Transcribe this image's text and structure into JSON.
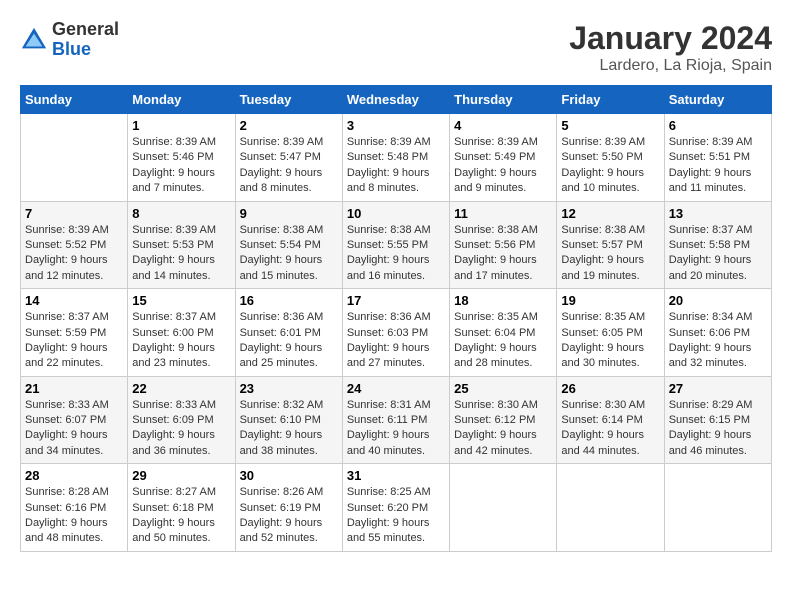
{
  "logo": {
    "general": "General",
    "blue": "Blue"
  },
  "title": "January 2024",
  "subtitle": "Lardero, La Rioja, Spain",
  "days_header": [
    "Sunday",
    "Monday",
    "Tuesday",
    "Wednesday",
    "Thursday",
    "Friday",
    "Saturday"
  ],
  "weeks": [
    [
      {
        "day": "",
        "info": ""
      },
      {
        "day": "1",
        "info": "Sunrise: 8:39 AM\nSunset: 5:46 PM\nDaylight: 9 hours\nand 7 minutes."
      },
      {
        "day": "2",
        "info": "Sunrise: 8:39 AM\nSunset: 5:47 PM\nDaylight: 9 hours\nand 8 minutes."
      },
      {
        "day": "3",
        "info": "Sunrise: 8:39 AM\nSunset: 5:48 PM\nDaylight: 9 hours\nand 8 minutes."
      },
      {
        "day": "4",
        "info": "Sunrise: 8:39 AM\nSunset: 5:49 PM\nDaylight: 9 hours\nand 9 minutes."
      },
      {
        "day": "5",
        "info": "Sunrise: 8:39 AM\nSunset: 5:50 PM\nDaylight: 9 hours\nand 10 minutes."
      },
      {
        "day": "6",
        "info": "Sunrise: 8:39 AM\nSunset: 5:51 PM\nDaylight: 9 hours\nand 11 minutes."
      }
    ],
    [
      {
        "day": "7",
        "info": "Sunrise: 8:39 AM\nSunset: 5:52 PM\nDaylight: 9 hours\nand 12 minutes."
      },
      {
        "day": "8",
        "info": "Sunrise: 8:39 AM\nSunset: 5:53 PM\nDaylight: 9 hours\nand 14 minutes."
      },
      {
        "day": "9",
        "info": "Sunrise: 8:38 AM\nSunset: 5:54 PM\nDaylight: 9 hours\nand 15 minutes."
      },
      {
        "day": "10",
        "info": "Sunrise: 8:38 AM\nSunset: 5:55 PM\nDaylight: 9 hours\nand 16 minutes."
      },
      {
        "day": "11",
        "info": "Sunrise: 8:38 AM\nSunset: 5:56 PM\nDaylight: 9 hours\nand 17 minutes."
      },
      {
        "day": "12",
        "info": "Sunrise: 8:38 AM\nSunset: 5:57 PM\nDaylight: 9 hours\nand 19 minutes."
      },
      {
        "day": "13",
        "info": "Sunrise: 8:37 AM\nSunset: 5:58 PM\nDaylight: 9 hours\nand 20 minutes."
      }
    ],
    [
      {
        "day": "14",
        "info": "Sunrise: 8:37 AM\nSunset: 5:59 PM\nDaylight: 9 hours\nand 22 minutes."
      },
      {
        "day": "15",
        "info": "Sunrise: 8:37 AM\nSunset: 6:00 PM\nDaylight: 9 hours\nand 23 minutes."
      },
      {
        "day": "16",
        "info": "Sunrise: 8:36 AM\nSunset: 6:01 PM\nDaylight: 9 hours\nand 25 minutes."
      },
      {
        "day": "17",
        "info": "Sunrise: 8:36 AM\nSunset: 6:03 PM\nDaylight: 9 hours\nand 27 minutes."
      },
      {
        "day": "18",
        "info": "Sunrise: 8:35 AM\nSunset: 6:04 PM\nDaylight: 9 hours\nand 28 minutes."
      },
      {
        "day": "19",
        "info": "Sunrise: 8:35 AM\nSunset: 6:05 PM\nDaylight: 9 hours\nand 30 minutes."
      },
      {
        "day": "20",
        "info": "Sunrise: 8:34 AM\nSunset: 6:06 PM\nDaylight: 9 hours\nand 32 minutes."
      }
    ],
    [
      {
        "day": "21",
        "info": "Sunrise: 8:33 AM\nSunset: 6:07 PM\nDaylight: 9 hours\nand 34 minutes."
      },
      {
        "day": "22",
        "info": "Sunrise: 8:33 AM\nSunset: 6:09 PM\nDaylight: 9 hours\nand 36 minutes."
      },
      {
        "day": "23",
        "info": "Sunrise: 8:32 AM\nSunset: 6:10 PM\nDaylight: 9 hours\nand 38 minutes."
      },
      {
        "day": "24",
        "info": "Sunrise: 8:31 AM\nSunset: 6:11 PM\nDaylight: 9 hours\nand 40 minutes."
      },
      {
        "day": "25",
        "info": "Sunrise: 8:30 AM\nSunset: 6:12 PM\nDaylight: 9 hours\nand 42 minutes."
      },
      {
        "day": "26",
        "info": "Sunrise: 8:30 AM\nSunset: 6:14 PM\nDaylight: 9 hours\nand 44 minutes."
      },
      {
        "day": "27",
        "info": "Sunrise: 8:29 AM\nSunset: 6:15 PM\nDaylight: 9 hours\nand 46 minutes."
      }
    ],
    [
      {
        "day": "28",
        "info": "Sunrise: 8:28 AM\nSunset: 6:16 PM\nDaylight: 9 hours\nand 48 minutes."
      },
      {
        "day": "29",
        "info": "Sunrise: 8:27 AM\nSunset: 6:18 PM\nDaylight: 9 hours\nand 50 minutes."
      },
      {
        "day": "30",
        "info": "Sunrise: 8:26 AM\nSunset: 6:19 PM\nDaylight: 9 hours\nand 52 minutes."
      },
      {
        "day": "31",
        "info": "Sunrise: 8:25 AM\nSunset: 6:20 PM\nDaylight: 9 hours\nand 55 minutes."
      },
      {
        "day": "",
        "info": ""
      },
      {
        "day": "",
        "info": ""
      },
      {
        "day": "",
        "info": ""
      }
    ]
  ]
}
